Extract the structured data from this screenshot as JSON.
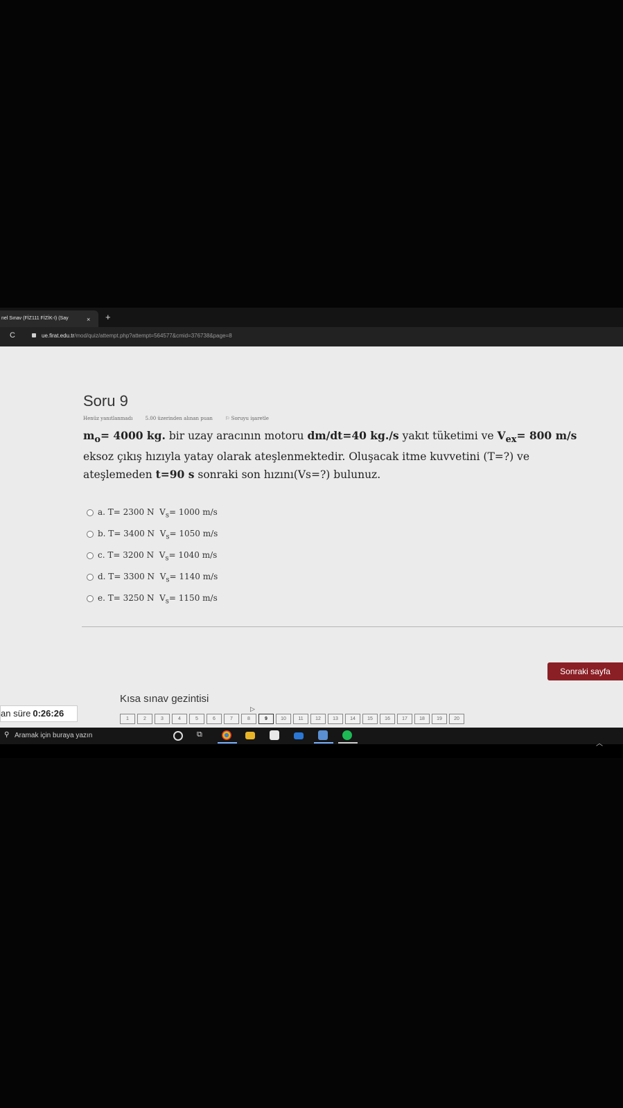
{
  "browser": {
    "tab_title": "nel Sınav (FİZ111 FİZİK-I) (Say",
    "tab_close": "×",
    "new_tab": "+",
    "reload": "C",
    "url_host": "ue.firat.edu.tr",
    "url_path": "/mod/quiz/attempt.php?attempt=564577&cmid=376738&page=8"
  },
  "question": {
    "title": "Soru 9",
    "status": "Henüz yanıtlanmadı",
    "points": "5.00 üzerinden alınan puan",
    "flag": "Soruyu işaretle",
    "text": {
      "m_label": "m",
      "m_sub": "o",
      "m_value": "= 4000 kg.",
      "part1": " bir uzay aracının motoru ",
      "rate": "dm/dt=40 kg./s",
      "part2": " yakıt tüketimi ve ",
      "v_label": "V",
      "v_sub": "ex",
      "v_value": "= 800 m/s",
      "part3": " eksoz çıkış hızıyla yatay olarak ateşlenmektedir. Oluşacak itme kuvvetini (T=?) ve ateşlemeden ",
      "time": "t=90 s",
      "part4": " sonraki son hızını(Vs=?) bulunuz."
    },
    "options": [
      {
        "label": "a. T= 2300 N",
        "v": "V",
        "sub": "s",
        "value": "= 1000 m/s"
      },
      {
        "label": "b. T= 3400 N",
        "v": "V",
        "sub": "s",
        "value": "= 1050 m/s"
      },
      {
        "label": "c. T= 3200 N",
        "v": "V",
        "sub": "s",
        "value": "= 1040 m/s"
      },
      {
        "label": "d. T= 3300 N",
        "v": "V",
        "sub": "s",
        "value": "= 1140 m/s"
      },
      {
        "label": "e. T= 3250 N",
        "v": "V",
        "sub": "s",
        "value": "= 1150 m/s"
      }
    ]
  },
  "next_button": "Sonraki sayfa",
  "navigation": {
    "title": "Kısa sınav gezintisi",
    "pages": [
      "1",
      "2",
      "3",
      "4",
      "5",
      "6",
      "7",
      "8",
      "9",
      "10",
      "11",
      "12",
      "13",
      "14",
      "15",
      "16",
      "17",
      "18",
      "19",
      "20"
    ],
    "current": "9"
  },
  "timer": {
    "label": "an süre",
    "value": "0:26:26"
  },
  "taskbar": {
    "search_placeholder": "Aramak için buraya yazın"
  },
  "colors": {
    "accent": "#8a1f25",
    "page_bg": "#ebebeb"
  }
}
